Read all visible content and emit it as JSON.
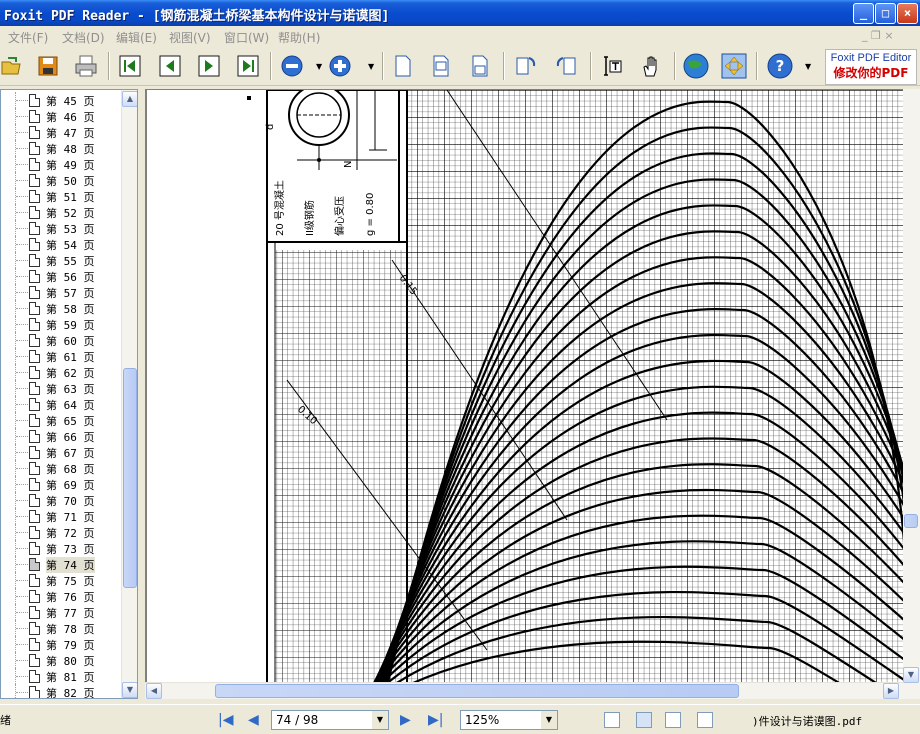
{
  "window": {
    "title": "Foxit PDF Reader - [钢筋混凝土桥梁基本构件设计与诺谟图]",
    "minimize": "_",
    "maximize": "□",
    "close": "×"
  },
  "menu": {
    "items": [
      {
        "label": "文件(F)"
      },
      {
        "label": "文档(D)"
      },
      {
        "label": "编辑(E)"
      },
      {
        "label": "视图(V)"
      },
      {
        "label": "窗口(W)"
      },
      {
        "label": "帮助(H)"
      }
    ],
    "restore_glyph": "_ ❐ ×"
  },
  "toolbar": {
    "buttons": [
      "open-icon",
      "save-icon",
      "print-icon",
      "first-page-icon",
      "prev-page-icon",
      "next-page-icon",
      "last-page-icon",
      "zoom-out-icon",
      "zoom-in-icon",
      "single-page-icon",
      "continuous-icon",
      "facing-icon",
      "rotate-cw-icon",
      "rotate-ccw-icon",
      "text-select-icon",
      "hand-tool-icon",
      "web-icon",
      "snapshot-icon",
      "help-icon"
    ],
    "ad_line1": "Foxit PDF Editor",
    "ad_line2": "修改你的PDF"
  },
  "pages": {
    "items": [
      "第 45 页",
      "第 46 页",
      "第 47 页",
      "第 48 页",
      "第 49 页",
      "第 50 页",
      "第 51 页",
      "第 52 页",
      "第 53 页",
      "第 54 页",
      "第 55 页",
      "第 56 页",
      "第 57 页",
      "第 58 页",
      "第 59 页",
      "第 60 页",
      "第 61 页",
      "第 62 页",
      "第 63 页",
      "第 64 页",
      "第 65 页",
      "第 66 页",
      "第 67 页",
      "第 68 页",
      "第 69 页",
      "第 70 页",
      "第 71 页",
      "第 72 页",
      "第 73 页",
      "第 74 页",
      "第 75 页",
      "第 76 页",
      "第 77 页",
      "第 78 页",
      "第 79 页",
      "第 80 页",
      "第 81 页",
      "第 82 页"
    ],
    "selected": "第 74 页"
  },
  "document": {
    "text_lines": [
      "20 号混凝土",
      "II级钢筋",
      "偏心受压",
      "g = 0.80"
    ],
    "curve_labels": [
      "0.15",
      "0.10"
    ],
    "dim_labels": [
      "d",
      "N"
    ]
  },
  "status": {
    "left_text": "绪",
    "page_value": "74 / 98",
    "zoom_value": "125%",
    "filename": ")件设计与诺谟图.pdf"
  },
  "colors": {
    "titlebar": "#0a4ccf",
    "accent": "#3169c6",
    "ad_red": "#d40000"
  }
}
